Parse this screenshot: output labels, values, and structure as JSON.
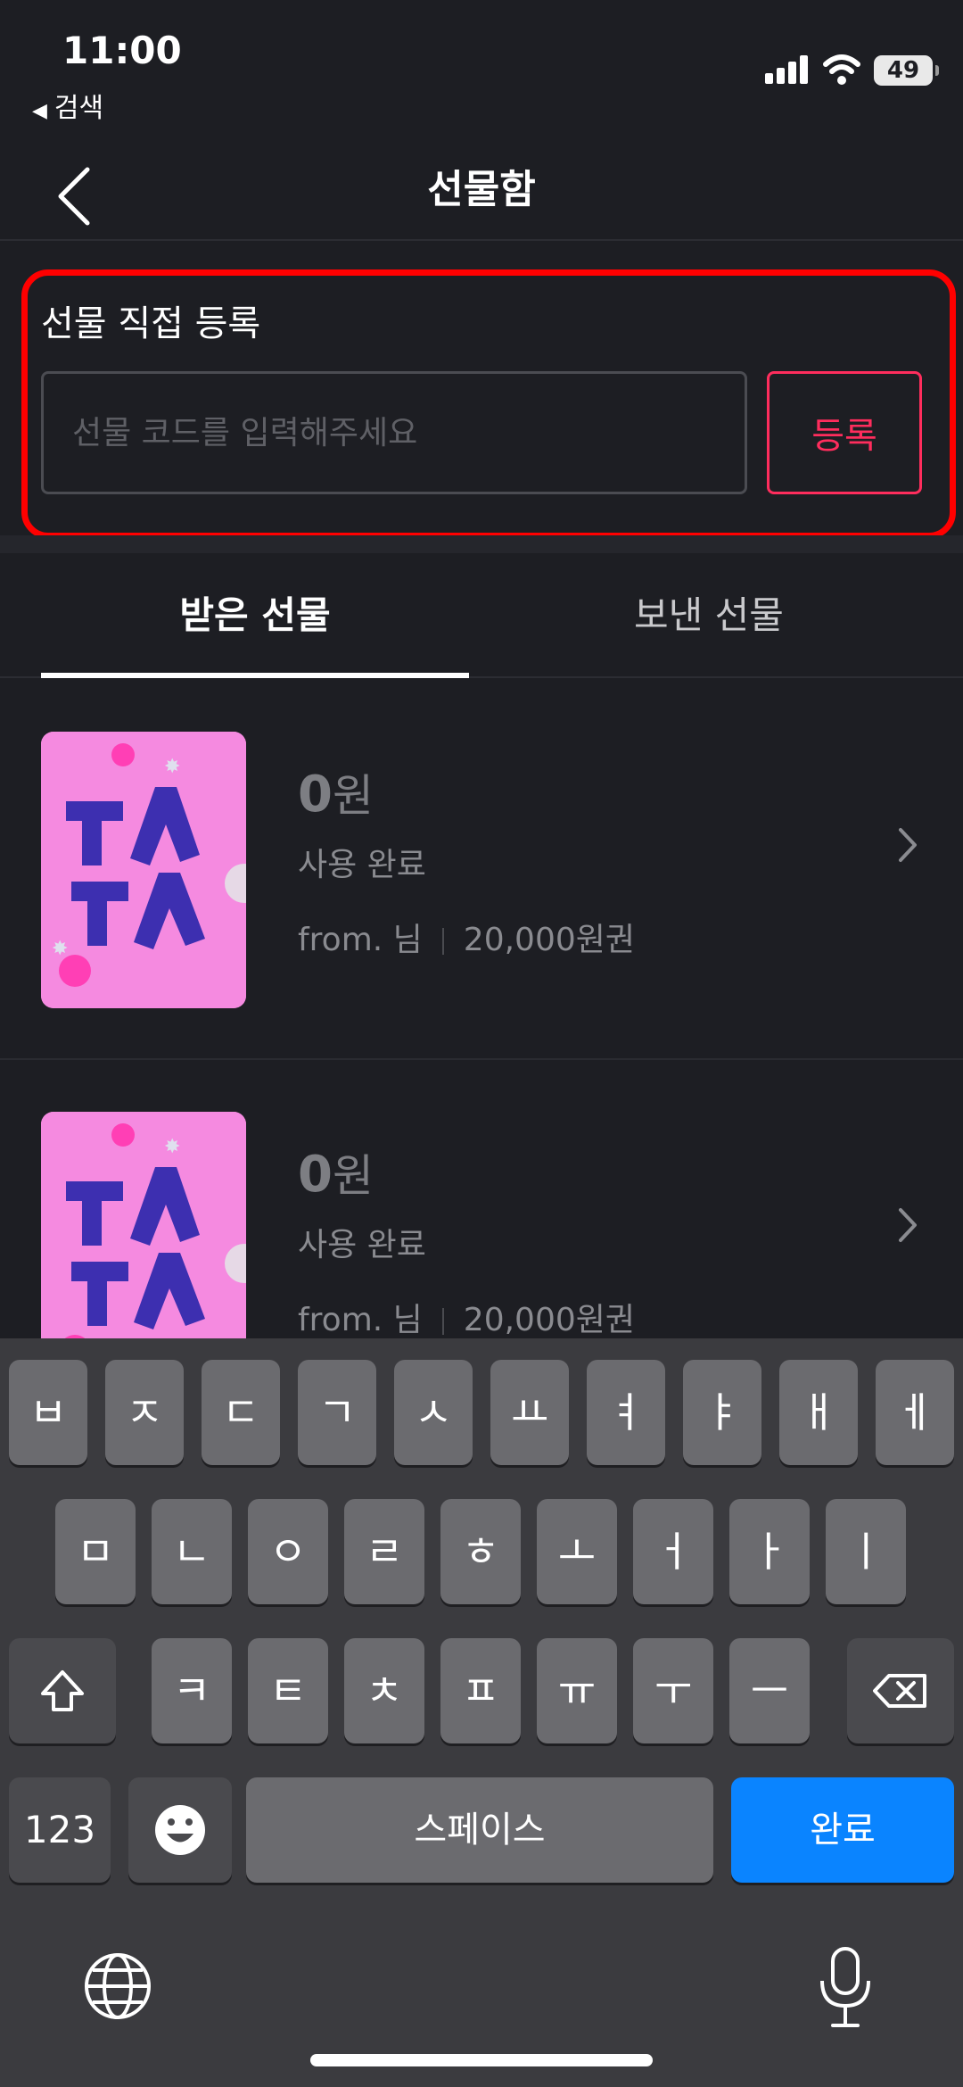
{
  "status_bar": {
    "time": "11:00",
    "back_app": "검색",
    "battery": "49"
  },
  "header": {
    "title": "선물함"
  },
  "register": {
    "label": "선물 직접 등록",
    "placeholder": "선물 코드를 입력해주세요",
    "button": "등록"
  },
  "tabs": [
    {
      "label": "받은 선물",
      "active": true
    },
    {
      "label": "보낸 선물",
      "active": false
    }
  ],
  "gifts": [
    {
      "amount": "0",
      "unit": "원",
      "status": "사용 완료",
      "from": "from. 님",
      "value": "20,000원권"
    },
    {
      "amount": "0",
      "unit": "원",
      "status": "사용 완료",
      "from": "from. 님",
      "value": "20,000원권"
    }
  ],
  "keyboard": {
    "row1": [
      "ㅂ",
      "ㅈ",
      "ㄷ",
      "ㄱ",
      "ㅅ",
      "ㅛ",
      "ㅕ",
      "ㅑ",
      "ㅐ",
      "ㅔ"
    ],
    "row2": [
      "ㅁ",
      "ㄴ",
      "ㅇ",
      "ㄹ",
      "ㅎ",
      "ㅗ",
      "ㅓ",
      "ㅏ",
      "ㅣ"
    ],
    "row3": [
      "ㅋ",
      "ㅌ",
      "ㅊ",
      "ㅍ",
      "ㅠ",
      "ㅜ",
      "ㅡ"
    ],
    "num_key": "123",
    "space": "스페이스",
    "done": "완료"
  },
  "colors": {
    "accent": "#ff2d5d",
    "highlight_border": "#ff0000",
    "done_key": "#0a84ff"
  }
}
